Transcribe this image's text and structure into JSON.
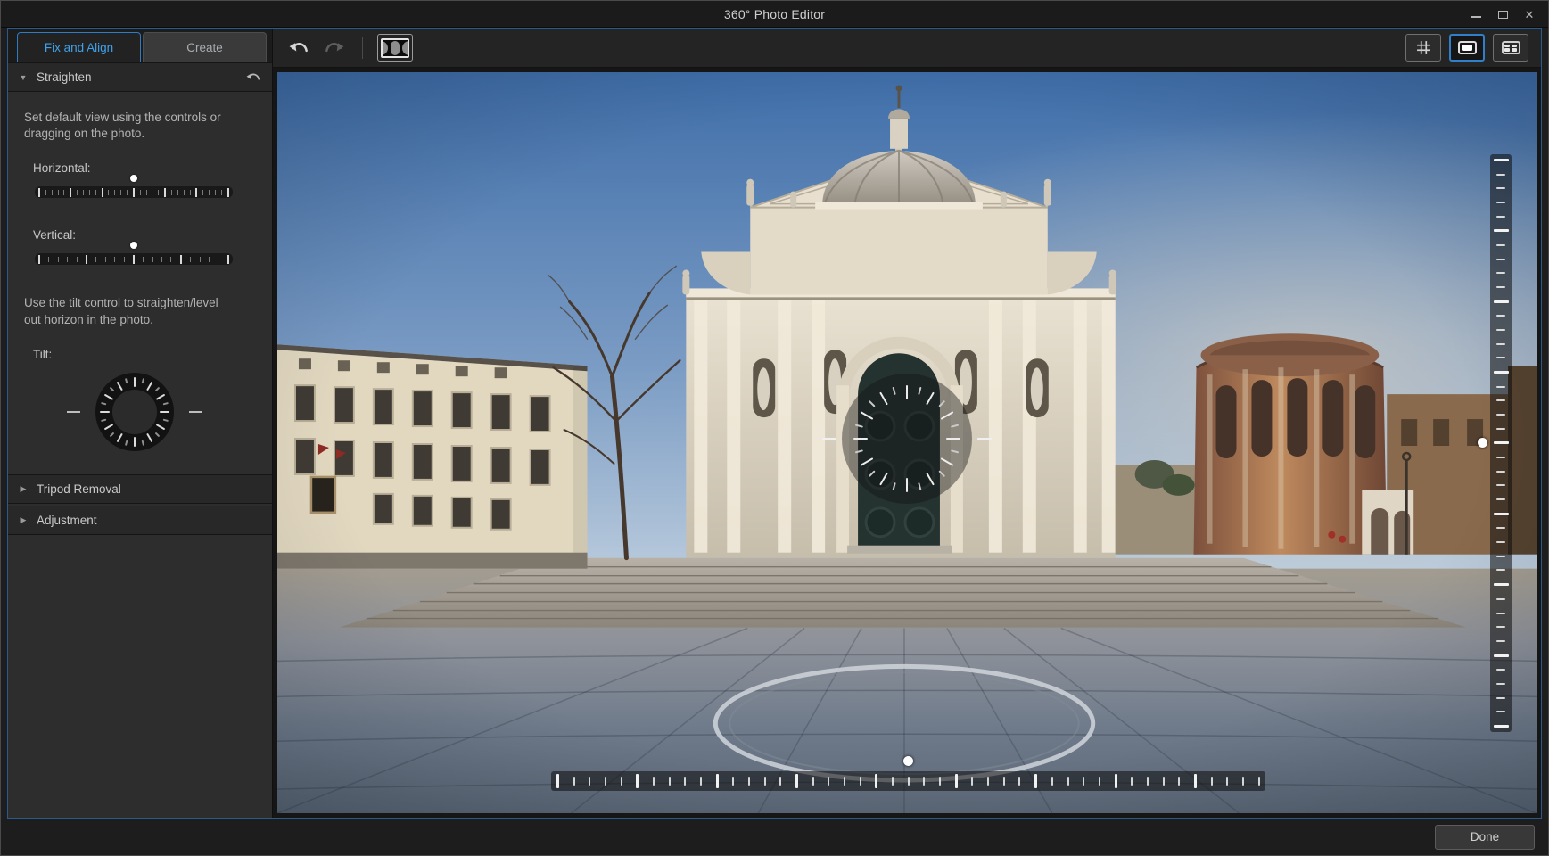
{
  "window": {
    "title": "360° Photo Editor",
    "controls": {
      "minimize": "minimize",
      "maximize": "maximize",
      "close_glyph": "✕"
    }
  },
  "tabs": [
    {
      "label": "Fix and Align",
      "active": true
    },
    {
      "label": "Create",
      "active": false
    }
  ],
  "glyphs": {
    "expanded": "▼",
    "collapsed": "▶"
  },
  "panel": {
    "straighten": {
      "header": "Straighten",
      "intro": "Set default view using the controls or dragging on the photo.",
      "horizontal_label": "Horizontal:",
      "horizontal_value_percent": 50,
      "vertical_label": "Vertical:",
      "vertical_value_percent": 50,
      "tilt_intro": "Use the tilt control to straighten/level out horizon in the photo.",
      "tilt_label": "Tilt:",
      "tilt_degrees": 0
    },
    "sections": [
      {
        "label": "Tripod Removal",
        "expanded": false
      },
      {
        "label": "Adjustment",
        "expanded": false
      }
    ]
  },
  "toolbar": {
    "undo_enabled": true,
    "redo_enabled": false,
    "panorama_view_active": true,
    "single_view_active": true,
    "multi_view_active": false
  },
  "viewport": {
    "scene": "360° panorama photo: baroque domed church with wide steps on a stone plaza, cream palazzo at left, brick rotunda at right, clear blue sky",
    "pan_percent": 50,
    "tilt_percent": 50
  },
  "footer": {
    "done_label": "Done"
  },
  "colors": {
    "accent_blue": "#2f7cc4",
    "tab_active_text": "#41a0e8",
    "content_border": "#2a5a8c",
    "panel_bg": "#2d2d2d",
    "toolbar_bg": "#242424",
    "handle_white": "#ffffff"
  }
}
